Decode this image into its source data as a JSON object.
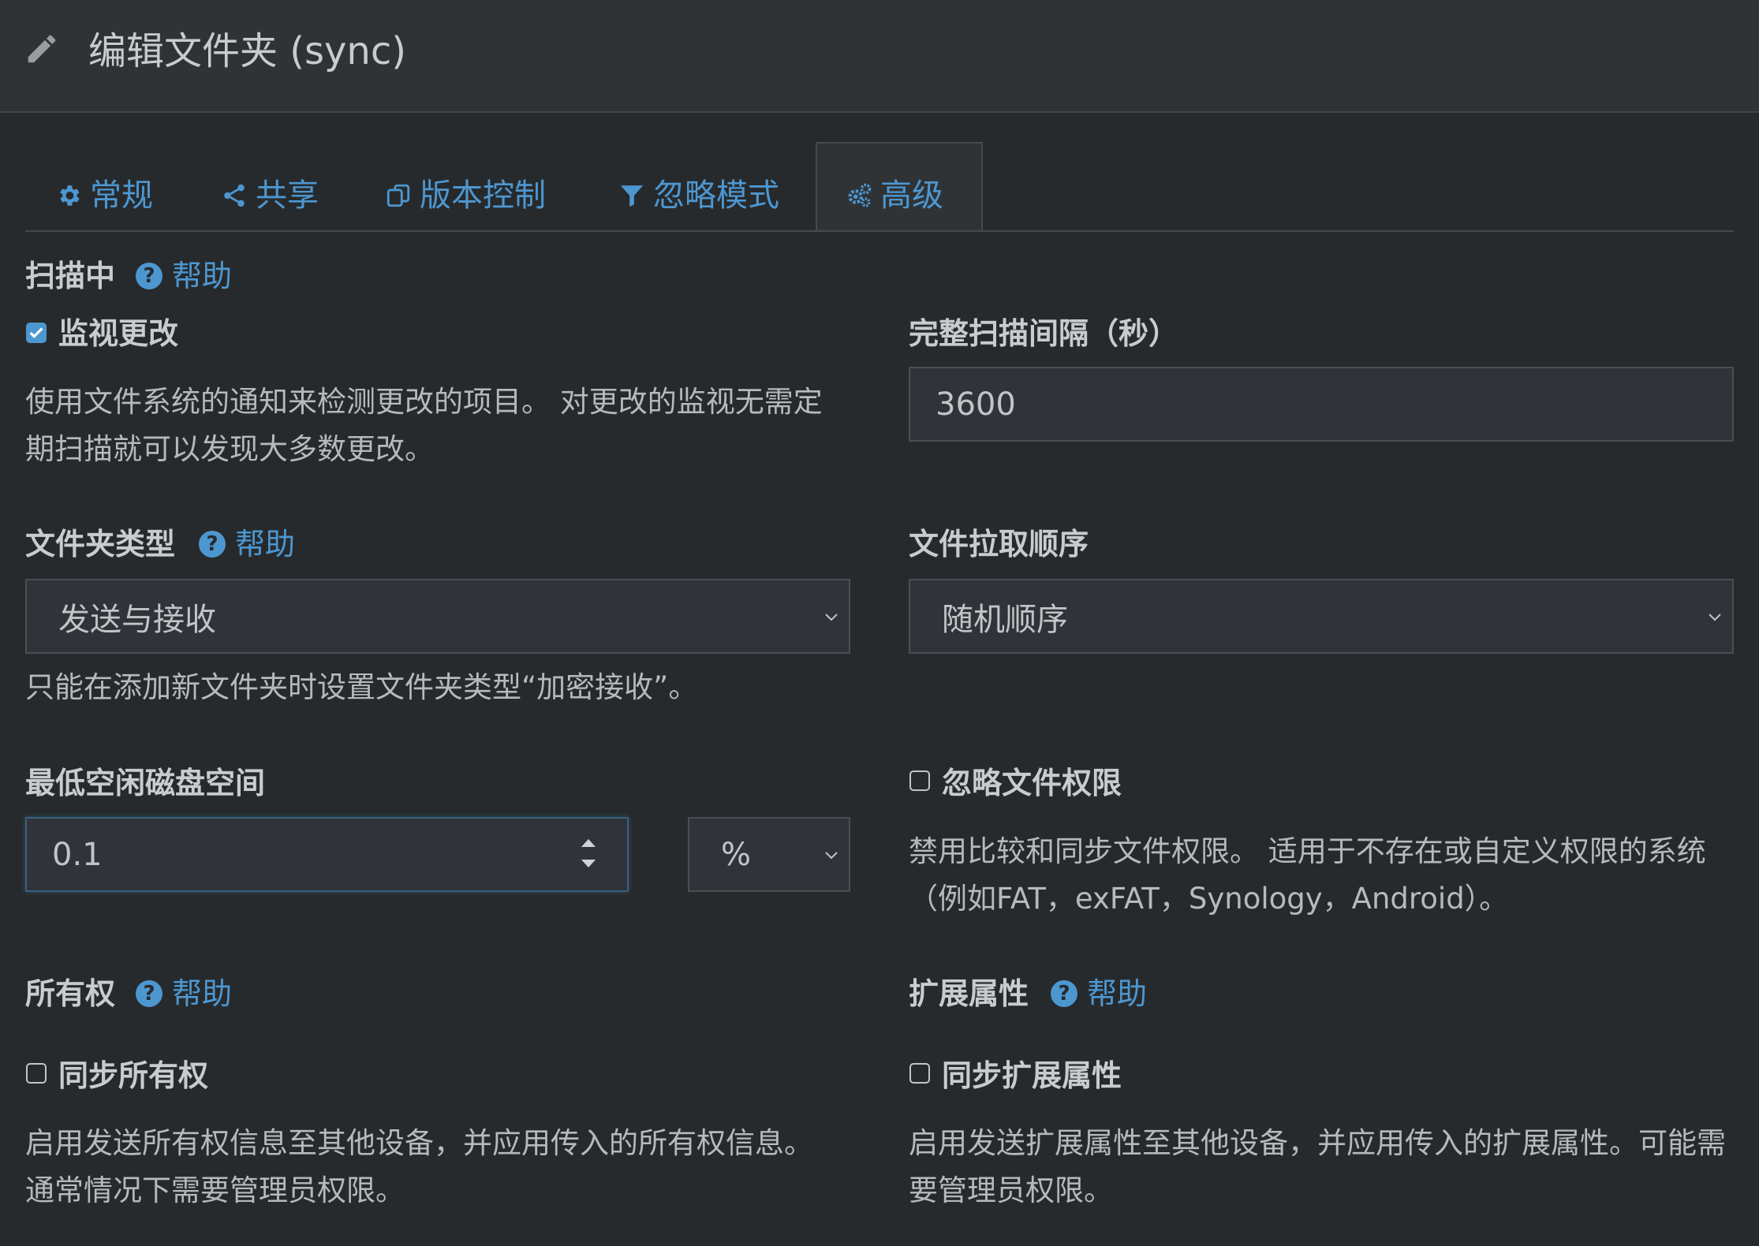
{
  "header": {
    "title": "编辑文件夹 (sync)"
  },
  "tabs": [
    {
      "label": "常规",
      "icon": "gear-icon"
    },
    {
      "label": "共享",
      "icon": "share-icon"
    },
    {
      "label": "版本控制",
      "icon": "copy-icon"
    },
    {
      "label": "忽略模式",
      "icon": "filter-icon"
    },
    {
      "label": "高级",
      "icon": "cogs-icon",
      "active": true
    }
  ],
  "help_label": "帮助",
  "scanning": {
    "label": "扫描中",
    "watch": {
      "label": "监视更改",
      "checked": true,
      "desc": "使用文件系统的通知来检测更改的项目。 对更改的监视无需定期扫描就可以发现大多数更改。"
    },
    "full_scan": {
      "label": "完整扫描间隔（秒）",
      "value": "3600"
    }
  },
  "folder_type": {
    "label": "文件夹类型",
    "value": "发送与接收",
    "note": "只能在添加新文件夹时设置文件夹类型“加密接收”。"
  },
  "pull_order": {
    "label": "文件拉取顺序",
    "value": "随机顺序"
  },
  "min_disk": {
    "label": "最低空闲磁盘空间",
    "value": "0.1",
    "unit": "%"
  },
  "ignore_perms": {
    "label": "忽略文件权限",
    "checked": false,
    "desc": "禁用比较和同步文件权限。 适用于不存在或自定义权限的系统（例如FAT，exFAT，Synology，Android）。"
  },
  "ownership": {
    "label": "所有权",
    "sync": {
      "label": "同步所有权",
      "checked": false,
      "desc": "启用发送所有权信息至其他设备，并应用传入的所有权信息。通常情况下需要管理员权限。"
    }
  },
  "xattrs": {
    "label": "扩展属性",
    "sync": {
      "label": "同步扩展属性",
      "checked": false,
      "desc": "启用发送扩展属性至其他设备，并应用传入的扩展属性。可能需要管理员权限。"
    }
  },
  "colors": {
    "accent": "#4d97d1",
    "background": "#272a2c",
    "header": "#2f3336"
  }
}
